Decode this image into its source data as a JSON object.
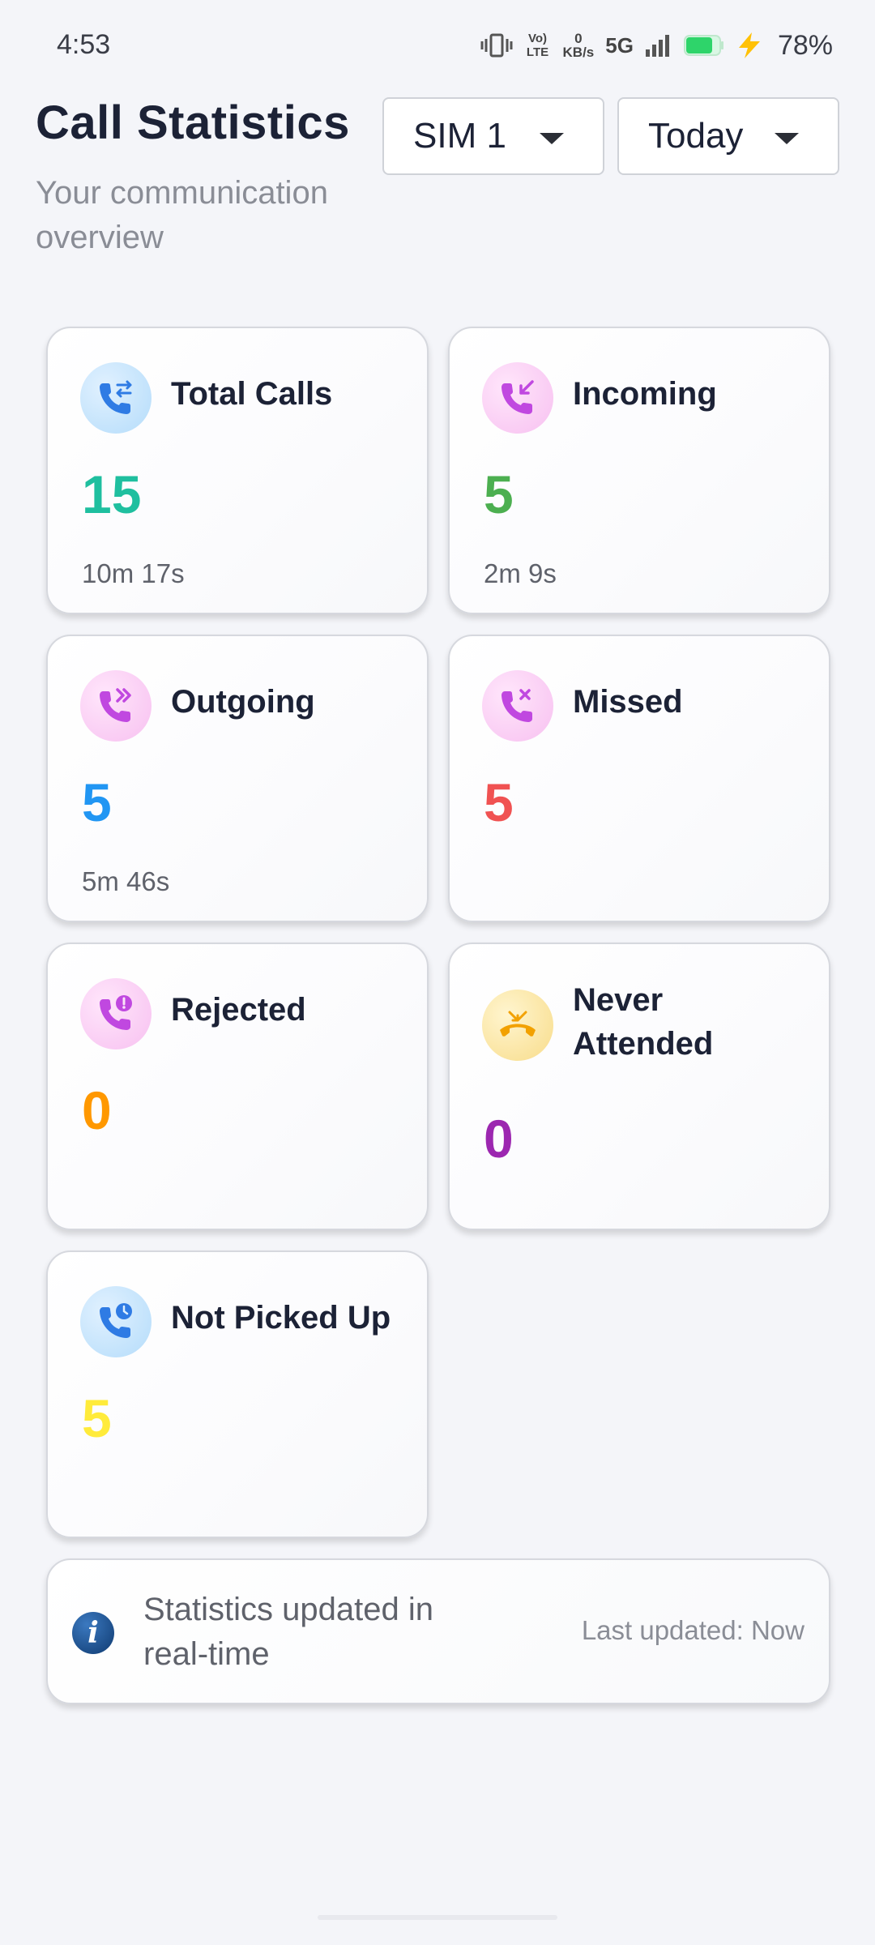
{
  "status_bar": {
    "time": "4:53",
    "net_speed_value": "0",
    "net_speed_unit": "KB/s",
    "volte": "Vo) LTE",
    "network": "5G",
    "battery_percent": "78%"
  },
  "header": {
    "title": "Call Statistics",
    "subtitle": "Your communication overview"
  },
  "filters": {
    "sim_selected": "SIM 1",
    "range_selected": "Today"
  },
  "cards": {
    "total": {
      "title": "Total Calls",
      "count": "15",
      "duration": "10m 17s",
      "color": "#1fbf9f",
      "icon": "call-exchange-icon"
    },
    "incoming": {
      "title": "Incoming",
      "count": "5",
      "duration": "2m 9s",
      "color": "#4caf50",
      "icon": "incoming-call-icon"
    },
    "outgoing": {
      "title": "Outgoing",
      "count": "5",
      "duration": "5m 46s",
      "color": "#2196f3",
      "icon": "outgoing-call-icon"
    },
    "missed": {
      "title": "Missed",
      "count": "5",
      "duration": "",
      "color": "#f05252",
      "icon": "missed-call-icon"
    },
    "rejected": {
      "title": "Rejected",
      "count": "0",
      "duration": "",
      "color": "#ff9800",
      "icon": "rejected-call-icon"
    },
    "never": {
      "title": "Never Attended",
      "count": "0",
      "duration": "",
      "color": "#9c27b0",
      "icon": "hangup-call-icon"
    },
    "not_picked": {
      "title": "Not Picked Up",
      "count": "5",
      "duration": "",
      "color": "#ffeb3b",
      "icon": "call-clock-icon"
    }
  },
  "info": {
    "message": "Statistics updated in real-time",
    "last_updated": "Last updated: Now"
  },
  "colors": {
    "background": "#f4f5f9",
    "icon_blue": "#2f7be4",
    "icon_pink": "#c048e0",
    "icon_yellow": "#f2a100"
  }
}
